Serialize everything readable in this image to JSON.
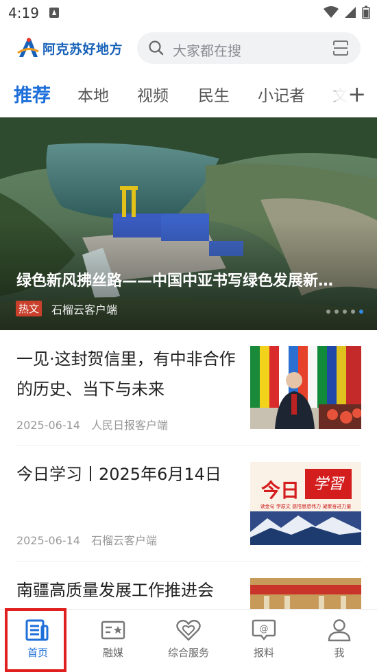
{
  "status_bar": {
    "time": "4:19"
  },
  "header": {
    "logo_text": "阿克苏好地方",
    "search_placeholder": "大家都在搜"
  },
  "tabs": [
    {
      "label": "推荐",
      "active": true
    },
    {
      "label": "本地",
      "active": false
    },
    {
      "label": "视频",
      "active": false
    },
    {
      "label": "民生",
      "active": false
    },
    {
      "label": "小记者",
      "active": false
    },
    {
      "label": "文",
      "active": false
    }
  ],
  "hero": {
    "title": "绿色新风拂丝路——中国中亚书写绿色发展新…",
    "tag": "热文",
    "source": "石榴云客户端"
  },
  "news": [
    {
      "title": "一见·这封贺信里，有中非合作的历史、当下与未来",
      "date": "2025-06-14",
      "source": "人民日报客户端"
    },
    {
      "title": "今日学习丨2025年6月14日",
      "date": "2025-06-14",
      "source": "石榴云客户端",
      "thumb_text": "今日",
      "thumb_script": "学習",
      "thumb_caption": "读金句 学原文 感悟思想伟力 凝聚奋进力量"
    },
    {
      "title": "南疆高质量发展工作推进会"
    }
  ],
  "bottom_nav": [
    {
      "label": "首页",
      "icon": "home-news-icon",
      "active": true
    },
    {
      "label": "融媒",
      "icon": "media-card-icon",
      "active": false
    },
    {
      "label": "综合服务",
      "icon": "heart-service-icon",
      "active": false
    },
    {
      "label": "报料",
      "icon": "report-at-icon",
      "active": false
    },
    {
      "label": "我",
      "icon": "user-icon",
      "active": false
    }
  ],
  "colors": {
    "accent": "#1e6fd9",
    "tag": "#c9402c",
    "highlight": "#e0201f"
  }
}
